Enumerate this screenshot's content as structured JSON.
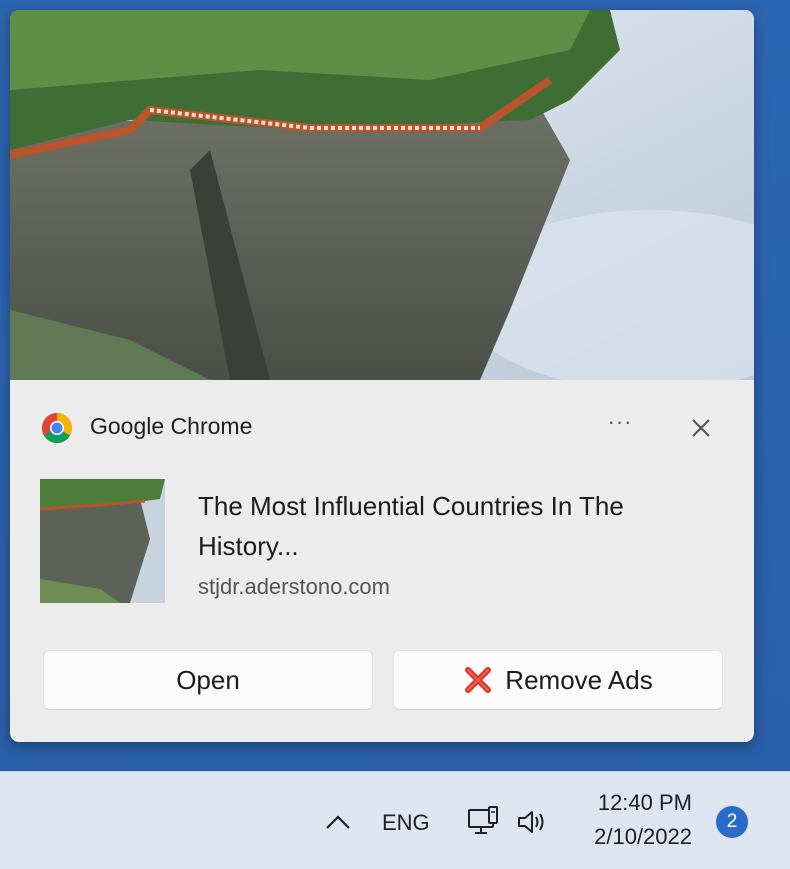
{
  "notification": {
    "app_name": "Google Chrome",
    "app_icon": "chrome-icon",
    "more_icon": "more-options-icon",
    "more_glyph": "···",
    "close_icon": "close-icon",
    "title": "The Most Influential Countries In The History...",
    "source": "stjdr.aderstono.com",
    "buttons": {
      "open_label": "Open",
      "remove_label": "Remove Ads",
      "remove_icon": "red-x-icon"
    },
    "colors": {
      "card": "#ececec",
      "remove_x": "#d9302a"
    }
  },
  "taskbar": {
    "overflow_icon": "chevron-up-icon",
    "language": "ENG",
    "network_icon": "network-icon",
    "volume_icon": "volume-icon",
    "time": "12:40 PM",
    "date": "2/10/2022",
    "notification_count": "2",
    "colors": {
      "background": "#dde6f0",
      "badge": "#2a6cc9"
    }
  }
}
